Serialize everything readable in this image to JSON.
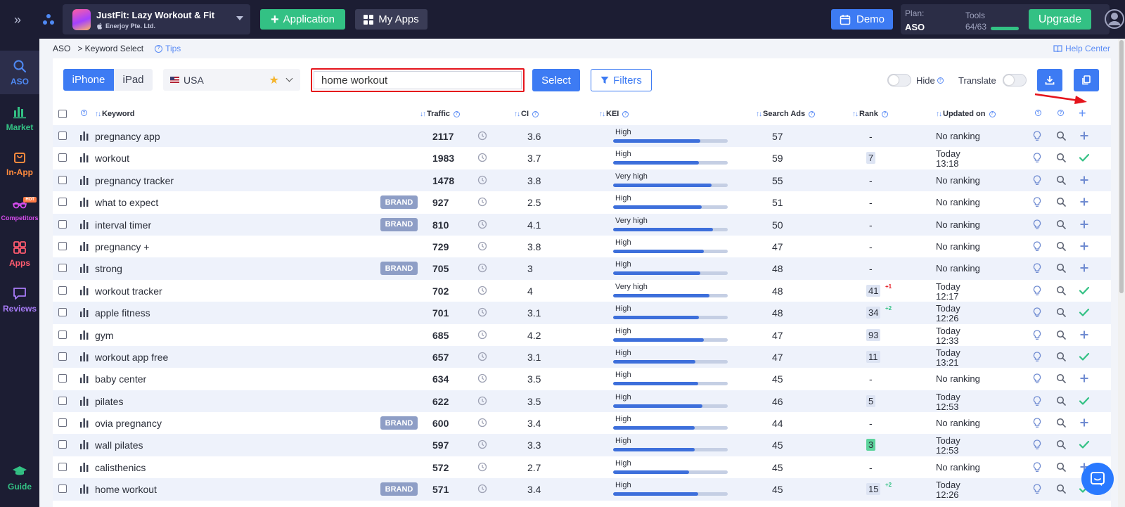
{
  "topbar": {
    "app_name": "JustFit: Lazy Workout & Fit",
    "app_developer": "Enerjoy Pte. Ltd.",
    "application_label": "Application",
    "my_apps_label": "My Apps",
    "demo_label": "Demo",
    "plan_label": "Plan:",
    "plan_value": "ASO",
    "tools_label": "Tools",
    "tools_value": "64/63",
    "upgrade_label": "Upgrade"
  },
  "sidebar": {
    "items": [
      {
        "label": "ASO",
        "color": "#4f8af5",
        "icon": "search-icon"
      },
      {
        "label": "Market",
        "color": "#33c184",
        "icon": "bar-chart-icon"
      },
      {
        "label": "In-App",
        "color": "#ff8a3d",
        "icon": "bag-icon"
      },
      {
        "label": "Competitors",
        "color": "#d94cf0",
        "icon": "glasses-icon",
        "badge": "HOT"
      },
      {
        "label": "Apps",
        "color": "#ff5b6f",
        "icon": "grid-icon"
      },
      {
        "label": "Reviews",
        "color": "#a77bf7",
        "icon": "chat-icon"
      },
      {
        "label": "Guide",
        "color": "#33c184",
        "icon": "graduation-cap-icon"
      }
    ]
  },
  "breadcrumb": {
    "root": "ASO",
    "current": "> Keyword Select",
    "tips": "Tips",
    "help_center": "Help Center"
  },
  "toolbar": {
    "device_iphone": "iPhone",
    "device_ipad": "iPad",
    "country": "USA",
    "search_value": "home workout",
    "select_label": "Select",
    "filters_label": "Filters",
    "hide_label": "Hide",
    "translate_label": "Translate"
  },
  "table": {
    "headers": {
      "keyword": "Keyword",
      "traffic": "Traffic",
      "ci": "CI",
      "kei": "KEI",
      "search_ads": "Search Ads",
      "rank": "Rank",
      "updated_on": "Updated on"
    },
    "rows": [
      {
        "keyword": "pregnancy app",
        "brand": "",
        "traffic": "2117",
        "ci": "3.6",
        "kei": "High",
        "kei_level": 0.76,
        "ads": "57",
        "rank": "",
        "rank_change": "",
        "updated": "No ranking",
        "updated_time": "",
        "added": false
      },
      {
        "keyword": "workout",
        "brand": "",
        "traffic": "1983",
        "ci": "3.7",
        "kei": "High",
        "kei_level": 0.75,
        "ads": "59",
        "rank": "7",
        "rank_change": "",
        "updated": "Today",
        "updated_time": "13:18",
        "added": true
      },
      {
        "keyword": "pregnancy tracker",
        "brand": "",
        "traffic": "1478",
        "ci": "3.8",
        "kei": "Very high",
        "kei_level": 0.86,
        "ads": "55",
        "rank": "",
        "rank_change": "",
        "updated": "No ranking",
        "updated_time": "",
        "added": false
      },
      {
        "keyword": "what to expect",
        "brand": "BRAND",
        "traffic": "927",
        "ci": "2.5",
        "kei": "High",
        "kei_level": 0.77,
        "ads": "51",
        "rank": "",
        "rank_change": "",
        "updated": "No ranking",
        "updated_time": "",
        "added": false
      },
      {
        "keyword": "interval timer",
        "brand": "BRAND",
        "traffic": "810",
        "ci": "4.1",
        "kei": "Very high",
        "kei_level": 0.87,
        "ads": "50",
        "rank": "",
        "rank_change": "",
        "updated": "No ranking",
        "updated_time": "",
        "added": false
      },
      {
        "keyword": "pregnancy +",
        "brand": "",
        "traffic": "729",
        "ci": "3.8",
        "kei": "High",
        "kei_level": 0.79,
        "ads": "47",
        "rank": "",
        "rank_change": "",
        "updated": "No ranking",
        "updated_time": "",
        "added": false
      },
      {
        "keyword": "strong",
        "brand": "BRAND",
        "traffic": "705",
        "ci": "3",
        "kei": "High",
        "kei_level": 0.76,
        "ads": "48",
        "rank": "",
        "rank_change": "",
        "updated": "No ranking",
        "updated_time": "",
        "added": false
      },
      {
        "keyword": "workout tracker",
        "brand": "",
        "traffic": "702",
        "ci": "4",
        "kei": "Very high",
        "kei_level": 0.84,
        "ads": "48",
        "rank": "41",
        "rank_change": "+1",
        "rank_change_color": "#e5141c",
        "updated": "Today",
        "updated_time": "12:17",
        "added": true
      },
      {
        "keyword": "apple fitness",
        "brand": "",
        "traffic": "701",
        "ci": "3.1",
        "kei": "High",
        "kei_level": 0.75,
        "ads": "48",
        "rank": "34",
        "rank_change": "+2",
        "rank_change_color": "#33c184",
        "updated": "Today",
        "updated_time": "12:26",
        "added": true
      },
      {
        "keyword": "gym",
        "brand": "",
        "traffic": "685",
        "ci": "4.2",
        "kei": "High",
        "kei_level": 0.79,
        "ads": "47",
        "rank": "93",
        "rank_change": "",
        "updated": "Today",
        "updated_time": "12:33",
        "added": false
      },
      {
        "keyword": "workout app free",
        "brand": "",
        "traffic": "657",
        "ci": "3.1",
        "kei": "High",
        "kei_level": 0.72,
        "ads": "47",
        "rank": "11",
        "rank_change": "",
        "updated": "Today",
        "updated_time": "13:21",
        "added": true
      },
      {
        "keyword": "baby center",
        "brand": "",
        "traffic": "634",
        "ci": "3.5",
        "kei": "High",
        "kei_level": 0.74,
        "ads": "45",
        "rank": "",
        "rank_change": "",
        "updated": "No ranking",
        "updated_time": "",
        "added": false
      },
      {
        "keyword": "pilates",
        "brand": "",
        "traffic": "622",
        "ci": "3.5",
        "kei": "High",
        "kei_level": 0.78,
        "ads": "46",
        "rank": "5",
        "rank_change": "",
        "updated": "Today",
        "updated_time": "12:53",
        "added": true
      },
      {
        "keyword": "ovia pregnancy",
        "brand": "BRAND",
        "traffic": "600",
        "ci": "3.4",
        "kei": "High",
        "kei_level": 0.71,
        "ads": "44",
        "rank": "",
        "rank_change": "",
        "updated": "No ranking",
        "updated_time": "",
        "added": false
      },
      {
        "keyword": "wall pilates",
        "brand": "",
        "traffic": "597",
        "ci": "3.3",
        "kei": "High",
        "kei_level": 0.71,
        "ads": "45",
        "rank": "3",
        "rank_green": true,
        "rank_change": "",
        "updated": "Today",
        "updated_time": "12:53",
        "added": true
      },
      {
        "keyword": "calisthenics",
        "brand": "",
        "traffic": "572",
        "ci": "2.7",
        "kei": "High",
        "kei_level": 0.66,
        "ads": "45",
        "rank": "",
        "rank_change": "",
        "updated": "No ranking",
        "updated_time": "",
        "added": false
      },
      {
        "keyword": "home workout",
        "brand": "BRAND",
        "traffic": "571",
        "ci": "3.4",
        "kei": "High",
        "kei_level": 0.74,
        "ads": "45",
        "rank": "15",
        "rank_change": "+2",
        "rank_change_color": "#33c184",
        "updated": "Today",
        "updated_time": "12:26",
        "added": true
      }
    ]
  },
  "colors": {
    "accent": "#3d7bf3",
    "green": "#33c184",
    "highlight_border": "#e5141c"
  }
}
